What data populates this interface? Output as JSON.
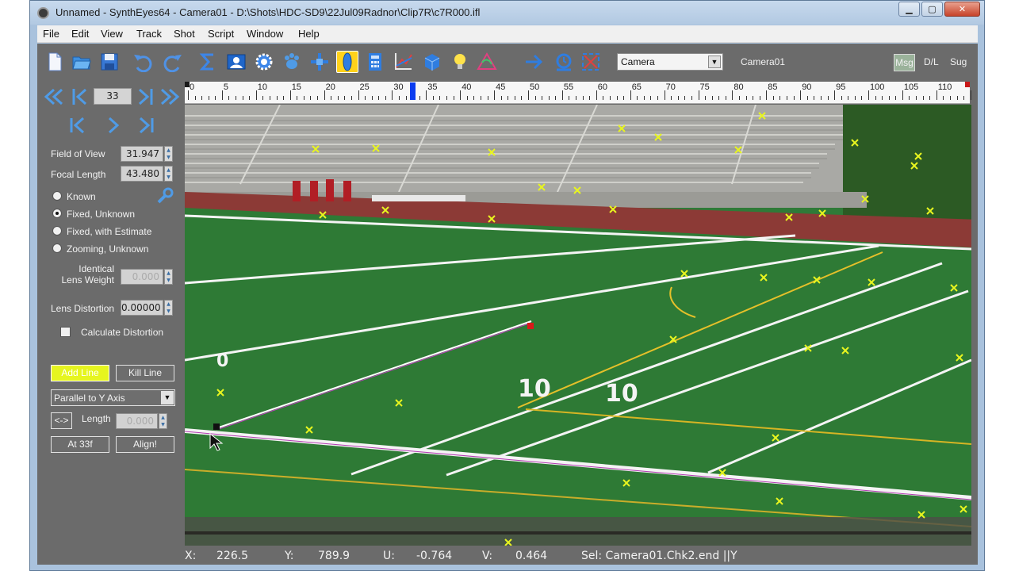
{
  "window": {
    "title": "Unnamed - SynthEyes64 - Camera01 - D:\\Shots\\HDC-SD9\\22Jul09Radnor\\Clip7R\\c7R000.ifl",
    "min": "▁",
    "max": "▢",
    "close": "✕"
  },
  "menu": {
    "items": [
      "File",
      "Edit",
      "View",
      "Track",
      "Shot",
      "Script",
      "Window",
      "Help"
    ]
  },
  "toolbar": {
    "camera_select": "Camera",
    "camera_label": "Camera01",
    "msg": "Msg",
    "dl": "D/L",
    "sug": "Sug",
    "accent": "#ffd21a"
  },
  "nav": {
    "frame": "33"
  },
  "lens": {
    "fov_label": "Field of View",
    "fov_value": "31.947",
    "focal_label": "Focal Length",
    "focal_value": "43.480",
    "opt_known": "Known",
    "opt_fixed_unknown": "Fixed, Unknown",
    "opt_fixed_estimate": "Fixed, with Estimate",
    "opt_zooming": "Zooming, Unknown",
    "weight_label1": "Identical",
    "weight_label2": "Lens Weight",
    "weight_value": "0.000",
    "distortion_label": "Lens Distortion",
    "distortion_value": "0.00000",
    "calc_distortion": "Calculate Distortion"
  },
  "lines": {
    "add_line": "Add Line",
    "kill_line": "Kill Line",
    "axis_select": "Parallel to Y Axis",
    "swap": "<->",
    "length_label": "Length",
    "length_value": "0.000",
    "at_frame": "At 33f",
    "align": "Align!"
  },
  "timeline": {
    "ticks": [
      "0",
      "5",
      "10",
      "15",
      "20",
      "25",
      "30",
      "35",
      "40",
      "45",
      "50",
      "55",
      "60",
      "65",
      "70",
      "75",
      "80",
      "85",
      "90",
      "95",
      "100",
      "105",
      "110"
    ],
    "current": 33
  },
  "status": {
    "x_label": "X:",
    "x": "226.5",
    "y_label": "Y:",
    "y": "789.9",
    "u_label": "U:",
    "u": "-0.764",
    "v_label": "V:",
    "v": "0.464",
    "sel": "Sel: Camera01.Chk2.end ||Y"
  }
}
